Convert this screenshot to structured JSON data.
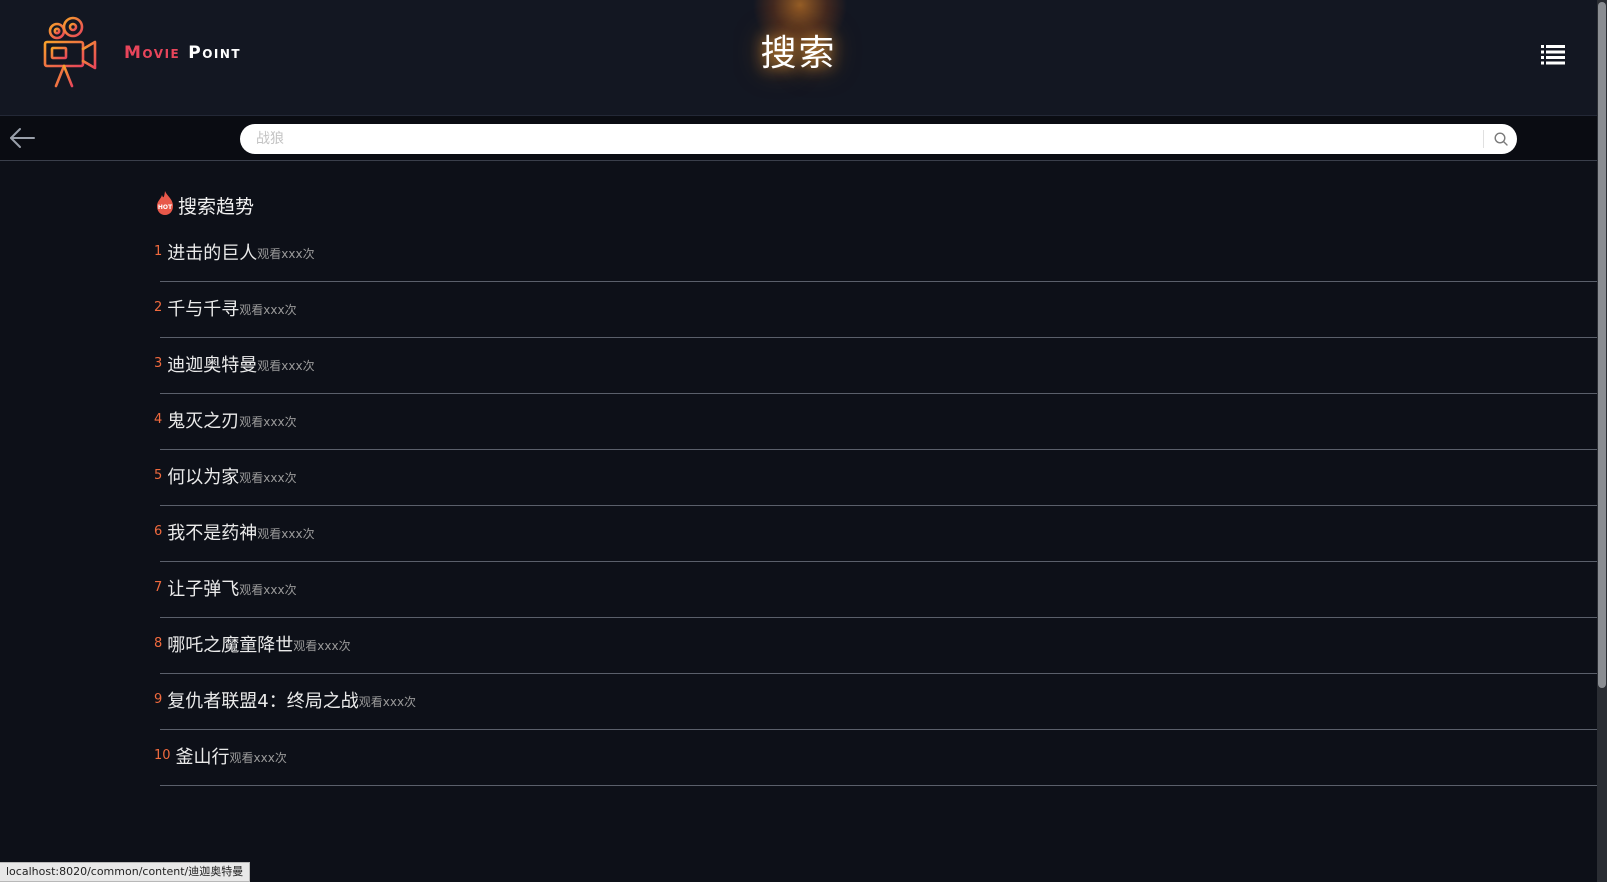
{
  "brand": {
    "name_part1": "Movie",
    "name_part2": "Point",
    "logo_icon": "movie-camera-icon"
  },
  "header": {
    "title": "搜索",
    "menu_icon": "list-menu-icon"
  },
  "search": {
    "placeholder": "战狼",
    "value": "",
    "back_icon": "arrow-left-icon",
    "search_icon": "magnifier-icon"
  },
  "trend": {
    "title": "搜索趋势",
    "icon": "hot-flame-icon",
    "hot_badge": "HOT",
    "items": [
      {
        "rank": "1",
        "title": "进击的巨人",
        "views": "观看xxx次"
      },
      {
        "rank": "2",
        "title": "千与千寻",
        "views": "观看xxx次"
      },
      {
        "rank": "3",
        "title": "迪迦奥特曼",
        "views": "观看xxx次"
      },
      {
        "rank": "4",
        "title": "鬼灭之刃",
        "views": "观看xxx次"
      },
      {
        "rank": "5",
        "title": "何以为家",
        "views": "观看xxx次"
      },
      {
        "rank": "6",
        "title": "我不是药神",
        "views": "观看xxx次"
      },
      {
        "rank": "7",
        "title": "让子弹飞",
        "views": "观看xxx次"
      },
      {
        "rank": "8",
        "title": "哪吒之魔童降世",
        "views": "观看xxx次"
      },
      {
        "rank": "9",
        "title": "复仇者联盟4：终局之战",
        "views": "观看xxx次"
      },
      {
        "rank": "10",
        "title": "釜山行",
        "views": "观看xxx次"
      }
    ]
  },
  "status_bar": {
    "url": "localhost:8020/common/content/迪迦奥特曼"
  },
  "colors": {
    "background": "#0d1018",
    "header_bg": "#131722",
    "accent_red": "#e8455b",
    "rank_orange": "#f06a3e",
    "logo_orange": "#f0812a"
  }
}
